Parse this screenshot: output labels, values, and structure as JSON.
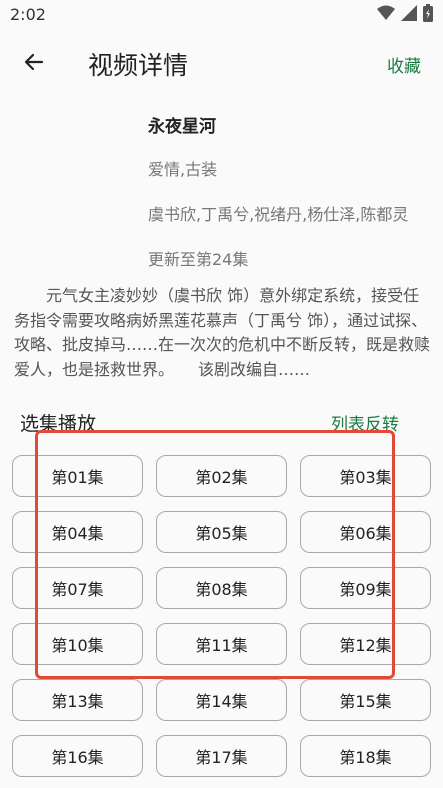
{
  "status_bar": {
    "time": "2:02",
    "icons": [
      "wifi-icon",
      "signal-icon",
      "battery-icon"
    ]
  },
  "header": {
    "title": "视频详情",
    "collect_label": "收藏"
  },
  "video": {
    "title": "永夜星河",
    "genre": "爱情,古装",
    "cast": "虞书欣,丁禹兮,祝绪丹,杨仕泽,陈都灵",
    "update": "更新至第24集",
    "description": "元气女主凌妙妙（虞书欣 饰）意外绑定系统，接受任务指令需要攻略病娇黑莲花慕声（丁禹兮 饰），通过试探、攻略、批皮掉马……在一次次的危机中不断反转，既是救赎爱人，也是拯救世界。　　该剧改编自……"
  },
  "episodes_section": {
    "title": "选集播放",
    "reverse_label": "列表反转",
    "episodes": [
      "第01集",
      "第02集",
      "第03集",
      "第04集",
      "第05集",
      "第06集",
      "第07集",
      "第08集",
      "第09集",
      "第10集",
      "第11集",
      "第12集",
      "第13集",
      "第14集",
      "第15集",
      "第16集",
      "第17集",
      "第18集"
    ]
  },
  "colors": {
    "accent": "#1e7a43",
    "highlight": "#e04b35",
    "border": "#a8a8a8"
  }
}
